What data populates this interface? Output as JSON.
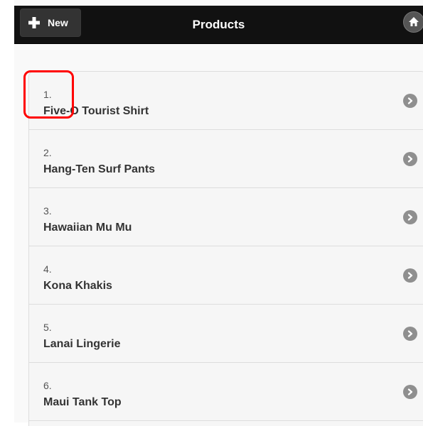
{
  "header": {
    "new_label": "New",
    "title": "Products",
    "new_icon": "plus-icon",
    "home_icon": "home-icon"
  },
  "products": [
    {
      "number": "1.",
      "name": "Five-O Tourist Shirt"
    },
    {
      "number": "2.",
      "name": "Hang-Ten Surf Pants"
    },
    {
      "number": "3.",
      "name": "Hawaiian Mu Mu"
    },
    {
      "number": "4.",
      "name": "Kona Khakis"
    },
    {
      "number": "5.",
      "name": "Lanai Lingerie"
    },
    {
      "number": "6.",
      "name": "Maui Tank Top"
    }
  ],
  "colors": {
    "header_bg": "#111111",
    "list_bg": "#f6f6f6",
    "highlight": "#ff0000",
    "arrow_icon": "#8f8f8f"
  }
}
